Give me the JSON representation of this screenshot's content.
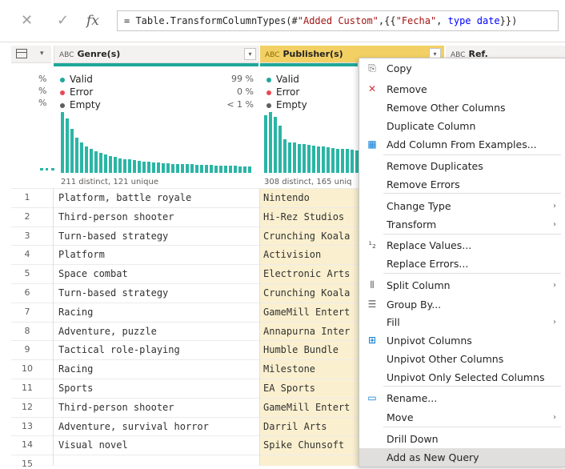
{
  "formula_bar": {
    "cancel_icon": "close-icon",
    "confirm_icon": "check-icon",
    "fx_label": "fx",
    "formula_prefix": "= Table.TransformColumnTypes(#",
    "formula_string1": "\"Added Custom\"",
    "formula_mid": ",{{",
    "formula_string2": "\"Fecha\"",
    "formula_mid2": ", ",
    "formula_keyword": "type date",
    "formula_suffix": "}})"
  },
  "columns": {
    "corner_dropdown": "▾",
    "genre": {
      "type_icon": "ABC",
      "name": "Genre(s)"
    },
    "publisher": {
      "type_icon": "ABC",
      "name": "Publisher(s)"
    },
    "ref": {
      "type_icon": "ABC",
      "name": "Ref."
    }
  },
  "profile": {
    "left_partial": [
      "%",
      "%",
      "%"
    ],
    "genre": {
      "valid_label": "Valid",
      "valid_pct": "99 %",
      "error_label": "Error",
      "error_pct": "0 %",
      "empty_label": "Empty",
      "empty_pct": "< 1 %",
      "stats": "211 distinct, 121 unique",
      "histogram": [
        1.0,
        0.9,
        0.72,
        0.58,
        0.5,
        0.44,
        0.4,
        0.36,
        0.33,
        0.3,
        0.28,
        0.26,
        0.24,
        0.23,
        0.22,
        0.21,
        0.2,
        0.19,
        0.18,
        0.17,
        0.17,
        0.16,
        0.16,
        0.15,
        0.15,
        0.14,
        0.14,
        0.14,
        0.13,
        0.13,
        0.13,
        0.13,
        0.12,
        0.12,
        0.12,
        0.12,
        0.12,
        0.11,
        0.11,
        0.11
      ]
    },
    "publisher": {
      "valid_label": "Valid",
      "error_label": "Error",
      "empty_label": "Empty",
      "stats": "308 distinct, 165 uniq",
      "histogram": [
        0.95,
        1.0,
        0.92,
        0.78,
        0.55,
        0.5,
        0.5,
        0.48,
        0.47,
        0.46,
        0.45,
        0.44,
        0.43,
        0.42,
        0.41,
        0.4,
        0.4,
        0.39,
        0.38,
        0.37,
        0.37,
        0.36,
        0.36
      ]
    },
    "colors": {
      "valid": "#1fa89a",
      "error": "#e74856",
      "empty": "#605e5c",
      "bar": "#2bb5a5"
    }
  },
  "rows": [
    {
      "num": "1",
      "genre": "Platform, battle royale",
      "publisher": "Nintendo"
    },
    {
      "num": "2",
      "genre": "Third-person shooter",
      "publisher": "Hi-Rez Studios"
    },
    {
      "num": "3",
      "genre": "Turn-based strategy",
      "publisher": "Crunching Koala"
    },
    {
      "num": "4",
      "genre": "Platform",
      "publisher": "Activision"
    },
    {
      "num": "5",
      "genre": "Space combat",
      "publisher": "Electronic Arts"
    },
    {
      "num": "6",
      "genre": "Turn-based strategy",
      "publisher": "Crunching Koala"
    },
    {
      "num": "7",
      "genre": "Racing",
      "publisher": "GameMill Entert"
    },
    {
      "num": "8",
      "genre": "Adventure, puzzle",
      "publisher": "Annapurna Inter"
    },
    {
      "num": "9",
      "genre": "Tactical role-playing",
      "publisher": "Humble Bundle"
    },
    {
      "num": "10",
      "genre": "Racing",
      "publisher": "Milestone"
    },
    {
      "num": "11",
      "genre": "Sports",
      "publisher": "EA Sports"
    },
    {
      "num": "12",
      "genre": "Third-person shooter",
      "publisher": "GameMill Entert"
    },
    {
      "num": "13",
      "genre": "Adventure, survival horror",
      "publisher": "Darril Arts"
    },
    {
      "num": "14",
      "genre": "Visual novel",
      "publisher": "Spike Chunsoft"
    },
    {
      "num": "15",
      "genre": "",
      "publisher": ""
    }
  ],
  "context_menu": {
    "items": [
      {
        "label": "Copy",
        "icon": "copy-icon",
        "glyph": "⎘",
        "submenu": false
      },
      {
        "label": "Remove",
        "icon": "remove-column-icon",
        "glyph": "✕",
        "submenu": false
      },
      {
        "label": "Remove Other Columns",
        "icon": "",
        "glyph": "",
        "submenu": false
      },
      {
        "label": "Duplicate Column",
        "icon": "",
        "glyph": "",
        "submenu": false
      },
      {
        "label": "Add Column From Examples...",
        "icon": "column-from-examples-icon",
        "glyph": "▦",
        "submenu": false
      },
      {
        "label": "Remove Duplicates",
        "icon": "",
        "glyph": "",
        "submenu": false
      },
      {
        "label": "Remove Errors",
        "icon": "",
        "glyph": "",
        "submenu": false
      },
      {
        "label": "Change Type",
        "icon": "",
        "glyph": "",
        "submenu": true
      },
      {
        "label": "Transform",
        "icon": "",
        "glyph": "",
        "submenu": true
      },
      {
        "label": "Replace Values...",
        "icon": "replace-values-icon",
        "glyph": "¹₂",
        "submenu": false
      },
      {
        "label": "Replace Errors...",
        "icon": "",
        "glyph": "",
        "submenu": false
      },
      {
        "label": "Split Column",
        "icon": "split-column-icon",
        "glyph": "⫴",
        "submenu": true
      },
      {
        "label": "Group By...",
        "icon": "group-by-icon",
        "glyph": "☰",
        "submenu": false
      },
      {
        "label": "Fill",
        "icon": "",
        "glyph": "",
        "submenu": true
      },
      {
        "label": "Unpivot Columns",
        "icon": "unpivot-icon",
        "glyph": "⊞",
        "submenu": false
      },
      {
        "label": "Unpivot Other Columns",
        "icon": "",
        "glyph": "",
        "submenu": false
      },
      {
        "label": "Unpivot Only Selected Columns",
        "icon": "",
        "glyph": "",
        "submenu": false
      },
      {
        "label": "Rename...",
        "icon": "rename-icon",
        "glyph": "▭",
        "submenu": false
      },
      {
        "label": "Move",
        "icon": "",
        "glyph": "",
        "submenu": true
      },
      {
        "label": "Drill Down",
        "icon": "",
        "glyph": "",
        "submenu": false
      },
      {
        "label": "Add as New Query",
        "icon": "",
        "glyph": "",
        "submenu": false
      }
    ],
    "submenu_arrow": "›",
    "highlight_color": "#e1dfdd"
  }
}
